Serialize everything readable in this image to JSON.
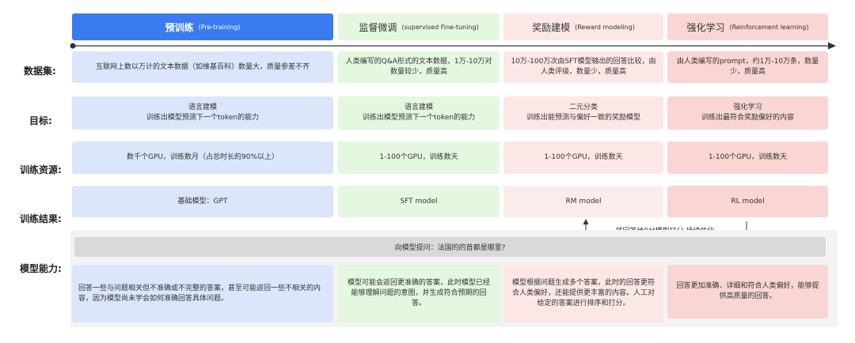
{
  "stages": [
    {
      "title": "预训练",
      "subtitle": "(Pre-training)"
    },
    {
      "title": "监督微调",
      "subtitle": "(supervised Fine-tuning)"
    },
    {
      "title": "奖励建模",
      "subtitle": "(Reward modeling)"
    },
    {
      "title": "强化学习",
      "subtitle": "(Reinforcement learning)"
    }
  ],
  "row_labels": {
    "dataset": "数据集:",
    "goal": "目标:",
    "resources": "训练资源:",
    "result": "训练结果:",
    "capability": "模型能力:"
  },
  "dataset": [
    "互联网上数以万计的文本数据（如维基百科）数量大，质量参差不齐",
    "人类编写的Q&A形式的文本数据，1万-10万对数量较少，质量高",
    "10万-100万次由SFT模型输出的回答比较，由人类评级，数量少，质量高",
    "由人类编写的prompt，约1万-10万条，数量少，质量高"
  ],
  "goal": [
    [
      "语言建模",
      "训练出模型预测下一个token的能力"
    ],
    [
      "语言建模",
      "训练出模型预测下一个token的能力"
    ],
    [
      "二元分类",
      "训练出能预测与偏好一致的奖励模型"
    ],
    [
      "强化学习",
      "训练出最符合奖励偏好的内容"
    ]
  ],
  "resources": [
    "数千个GPU，训练数月（占总时长的90%以上）",
    "1-100个GPU，训练数天",
    "1-100个GPU，训练数天",
    "1-100个GPU，训练数天"
  ],
  "result": [
    "基础模型：GPT",
    "SFT model",
    "RM model",
    "RL model"
  ],
  "feedback": "将回答给RM模型打分 持续优化",
  "question": "向模型提问：法国的的首都是哪里?",
  "capability": [
    "回答一些与问题相关但不准确或不完整的答案，甚至可能返回一些不相关的内容，因为模型尚未学会如何准确回答具体问题。",
    "模型可能会返回更准确的答案，此时模型已经能够理解问题的意图，并生成符合预期的回答。",
    "模型根据问题生成多个答案，此时的回答更符合人类偏好，还能提供更丰富的内容。人工对给定的答案进行排序和打分。",
    "回答更加准确、详细和符合人类偏好，能够提供高质量的回答。"
  ],
  "colors": {
    "pretrain_header": "#3a7bf0",
    "pretrain_cell": "#dbe6fb",
    "sft": "#e4f7df",
    "rm": "#fbe7e6",
    "rl": "#f9d6d4"
  }
}
